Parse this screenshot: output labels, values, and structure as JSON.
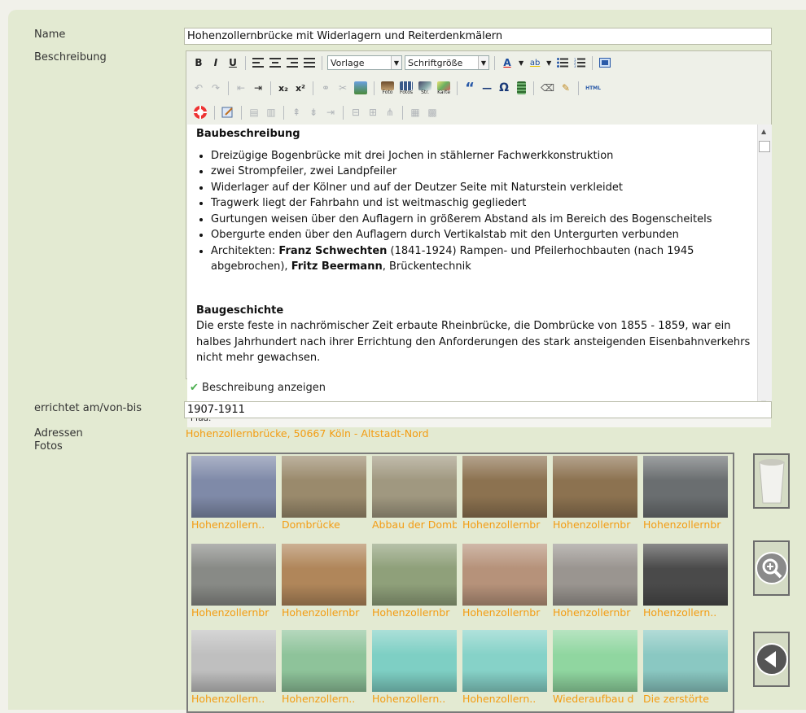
{
  "form": {
    "name_label": "Name",
    "name_value": "Hohenzollernbrücke mit Widerlagern und Reiterdenkmälern",
    "desc_label": "Beschreibung",
    "built_label": "errichtet am/von-bis",
    "built_value": "1907-1911",
    "address_label": "Adressen",
    "address_value": "Hohenzollernbrücke, 50667 Köln - Altstadt-Nord",
    "photos_label": "Fotos",
    "show_desc_label": "Beschreibung anzeigen"
  },
  "toolbar": {
    "bold": "B",
    "italic": "I",
    "underline": "U",
    "format_select": "Vorlage",
    "size_select": "Schriftgröße",
    "html_label": "HTML",
    "foto_label": "Foto",
    "fotos_label": "Fotos",
    "str_label": "Str.",
    "karte_label": "Karte",
    "quote": "“",
    "dash": "—",
    "omega": "Ω",
    "sub": "x₂",
    "sup": "x²",
    "path_label": "Pfad:"
  },
  "content": {
    "heading1": "Baubeschreibung",
    "bullets": [
      "Dreizügige Bogenbrücke  mit drei  Jochen in stählerner Fachwerkkonstruktion",
      "zwei Strompfeiler, zwei Landpfeiler",
      "Widerlager auf der Kölner und auf der Deutzer Seite mit Naturstein verkleidet",
      "Tragwerk liegt der Fahrbahn und ist weitmaschig gegliedert",
      "Gurtungen weisen über den Auflagern in größerem Abstand als im Bereich des Bogenscheitels",
      "Obergurte enden über den Auflagern  durch Vertikalstab mit den Untergurten verbunden"
    ],
    "arch_prefix": "Architekten: ",
    "arch_name1": "Franz Schwechten",
    "arch_mid": " (1841-1924) Rampen- und Pfeilerhochbauten (nach 1945 abgebrochen), ",
    "arch_name2": "Fritz Beermann",
    "arch_suffix": ", Brückentechnik",
    "heading2": "Baugeschichte",
    "paragraph": "Die erste feste in nachrömischer Zeit erbaute Rheinbrücke, die Dombrücke von 1855 - 1859, war ein halbes Jahrhundert nach ihrer Errichtung den Anforderungen des stark ansteigenden Eisenbahnverkehrs nicht mehr gewachsen."
  },
  "photos": [
    {
      "caption": "Hohenzollern..",
      "tone": "#7f8aa8"
    },
    {
      "caption": "Dombrücke",
      "tone": "#9a8a6c"
    },
    {
      "caption": "Abbau der Domb",
      "tone": "#a09880"
    },
    {
      "caption": "Hohenzollernbr",
      "tone": "#8c7250"
    },
    {
      "caption": "Hohenzollernbr",
      "tone": "#8c7250"
    },
    {
      "caption": "Hohenzollernbr",
      "tone": "#6a6e70"
    },
    {
      "caption": "Hohenzollernbr",
      "tone": "#888a86"
    },
    {
      "caption": "Hohenzollernbr",
      "tone": "#b0865a"
    },
    {
      "caption": "Hohenzollernbr",
      "tone": "#8fa07a"
    },
    {
      "caption": "Hohenzollernbr",
      "tone": "#b6927a"
    },
    {
      "caption": "Hohenzollernbr",
      "tone": "#9a9590"
    },
    {
      "caption": "Hohenzollern..",
      "tone": "#4a4a4a"
    },
    {
      "caption": "Hohenzollern..",
      "tone": "#bfbfbf"
    },
    {
      "caption": "Hohenzollern..",
      "tone": "#8ec39a"
    },
    {
      "caption": "Hohenzollern..",
      "tone": "#7ecfc4"
    },
    {
      "caption": "Hohenzollern..",
      "tone": "#86d2c8"
    },
    {
      "caption": "Wiederaufbau d",
      "tone": "#90d6a0"
    },
    {
      "caption": "Die zerstörte",
      "tone": "#8ac8c2"
    }
  ],
  "colors": {
    "accent_link": "#f39c12",
    "panel_bg": "#e3ead2",
    "check": "#4caf50"
  }
}
